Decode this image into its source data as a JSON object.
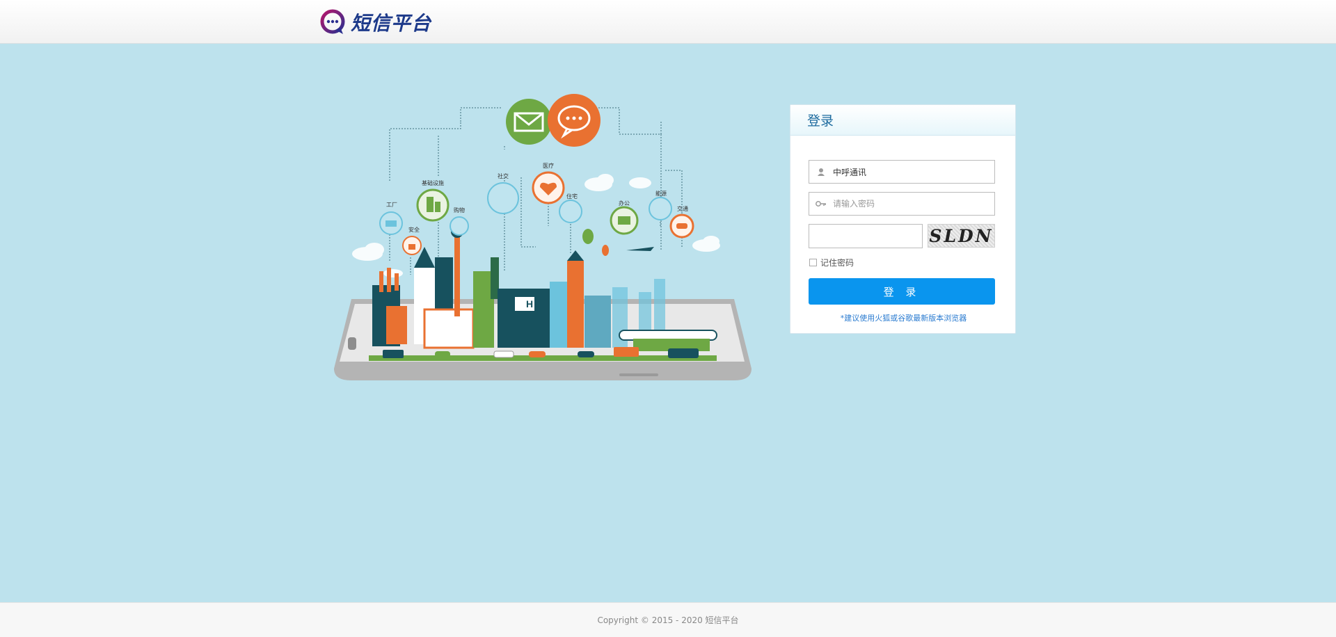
{
  "header": {
    "logo_text": "短信平台",
    "logo_icon": "chat-bubble-logo-icon"
  },
  "illustration": {
    "labels": {
      "factory": "工厂",
      "safety": "安全",
      "infrastructure": "基础设施",
      "shopping": "购物",
      "social": "社交",
      "medical": "医疗",
      "housing": "住宅",
      "office": "办公",
      "energy": "能源",
      "traffic": "交通",
      "hospital_sign": "H"
    },
    "icons": [
      "mail-icon",
      "chat-icon",
      "factory-icon",
      "lock-icon",
      "building-icon",
      "cart-icon",
      "people-icon",
      "heart-icon",
      "house-icon",
      "briefcase-icon",
      "energy-icon",
      "car-icon"
    ],
    "colors": {
      "green": "#6ea844",
      "orange": "#e97131",
      "teal": "#6cc3dd",
      "dark_teal": "#17515e"
    }
  },
  "login": {
    "title": "登录",
    "username_value": "中呼通讯",
    "username_icon": "user-icon",
    "password_placeholder": "请输入密码",
    "password_icon": "key-icon",
    "captcha_value": "",
    "captcha_text": "SLDN",
    "remember_label": "记住密码",
    "submit_label": "登 录",
    "browser_tip": "*建议使用火狐或谷歌最新版本浏览器",
    "accent_color": "#0a95ee"
  },
  "footer": {
    "copyright": "Copyright © 2015 - 2020 短信平台"
  }
}
